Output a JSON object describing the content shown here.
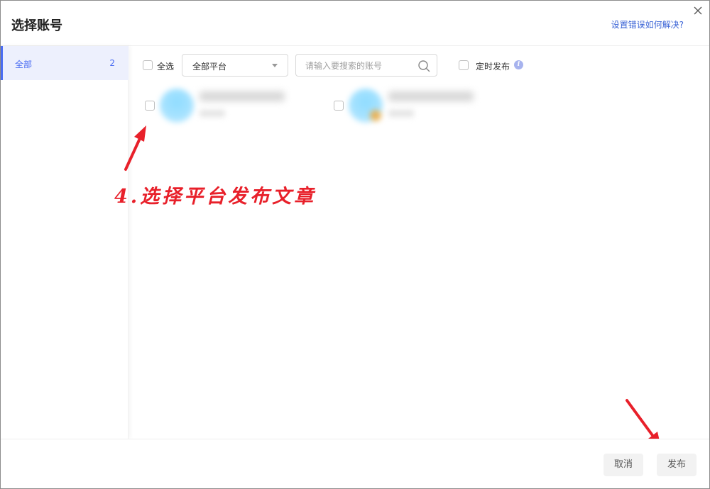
{
  "dialog": {
    "title": "选择账号",
    "help_link": "设置错误如何解决?",
    "close_icon": "close-icon"
  },
  "sidebar": {
    "items": [
      {
        "label": "全部",
        "count": "2"
      }
    ]
  },
  "toolbar": {
    "select_all_label": "全选",
    "platform_select_value": "全部平台",
    "search_placeholder": "请输入要搜索的账号",
    "schedule_label": "定时发布",
    "info_icon_glyph": "i"
  },
  "accounts": [
    {
      "avatar": "blurred-avatar",
      "checked": false
    },
    {
      "avatar": "blurred-avatar-with-badge",
      "checked": false
    }
  ],
  "annotation": {
    "text": "4.选择平台发布文章",
    "color": "#e8202a"
  },
  "footer": {
    "cancel_label": "取消",
    "publish_label": "发布"
  },
  "colors": {
    "accent": "#4a6cf2",
    "link": "#3a63d6",
    "annotation_red": "#e8202a"
  }
}
